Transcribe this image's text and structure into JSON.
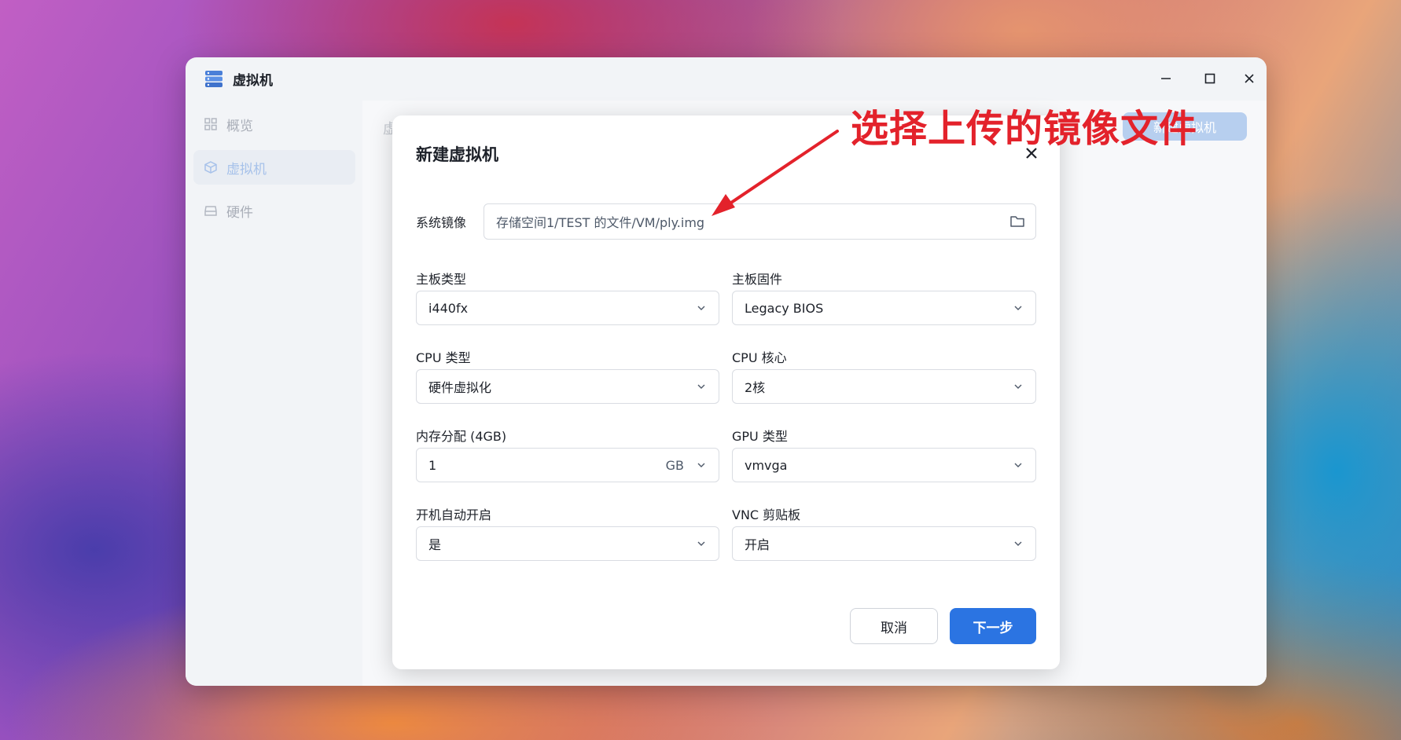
{
  "window": {
    "title": "虚拟机",
    "controls": {
      "minimize": "minimize-icon",
      "maximize": "maximize-icon",
      "close": "close-icon"
    }
  },
  "sidebar": {
    "items": [
      {
        "label": "概览",
        "icon": "grid-icon",
        "active": false
      },
      {
        "label": "虚拟机",
        "icon": "cube-icon",
        "active": true
      },
      {
        "label": "硬件",
        "icon": "drive-icon",
        "active": false
      }
    ]
  },
  "content": {
    "title": "虚",
    "new_vm_button": "新建虚拟机"
  },
  "dialog": {
    "title": "新建虚拟机",
    "system_image": {
      "label": "系统镜像",
      "value": "存储空间1/TEST 的文件/VM/ply.img"
    },
    "board_type": {
      "label": "主板类型",
      "value": "i440fx"
    },
    "board_firmware": {
      "label": "主板固件",
      "value": "Legacy BIOS"
    },
    "cpu_type": {
      "label": "CPU 类型",
      "value": "硬件虚拟化"
    },
    "cpu_cores": {
      "label": "CPU 核心",
      "value": "2核"
    },
    "memory": {
      "label": "内存分配 (4GB)",
      "value": "1",
      "unit": "GB"
    },
    "gpu_type": {
      "label": "GPU 类型",
      "value": "vmvga"
    },
    "autostart": {
      "label": "开机自动开启",
      "value": "是"
    },
    "vnc_clipboard": {
      "label": "VNC 剪贴板",
      "value": "开启"
    },
    "cancel_label": "取消",
    "next_label": "下一步"
  },
  "annotation": {
    "text": "选择上传的镜像文件",
    "color": "#e3222b"
  },
  "colors": {
    "primary": "#2b74e2",
    "text": "#1d2129"
  }
}
